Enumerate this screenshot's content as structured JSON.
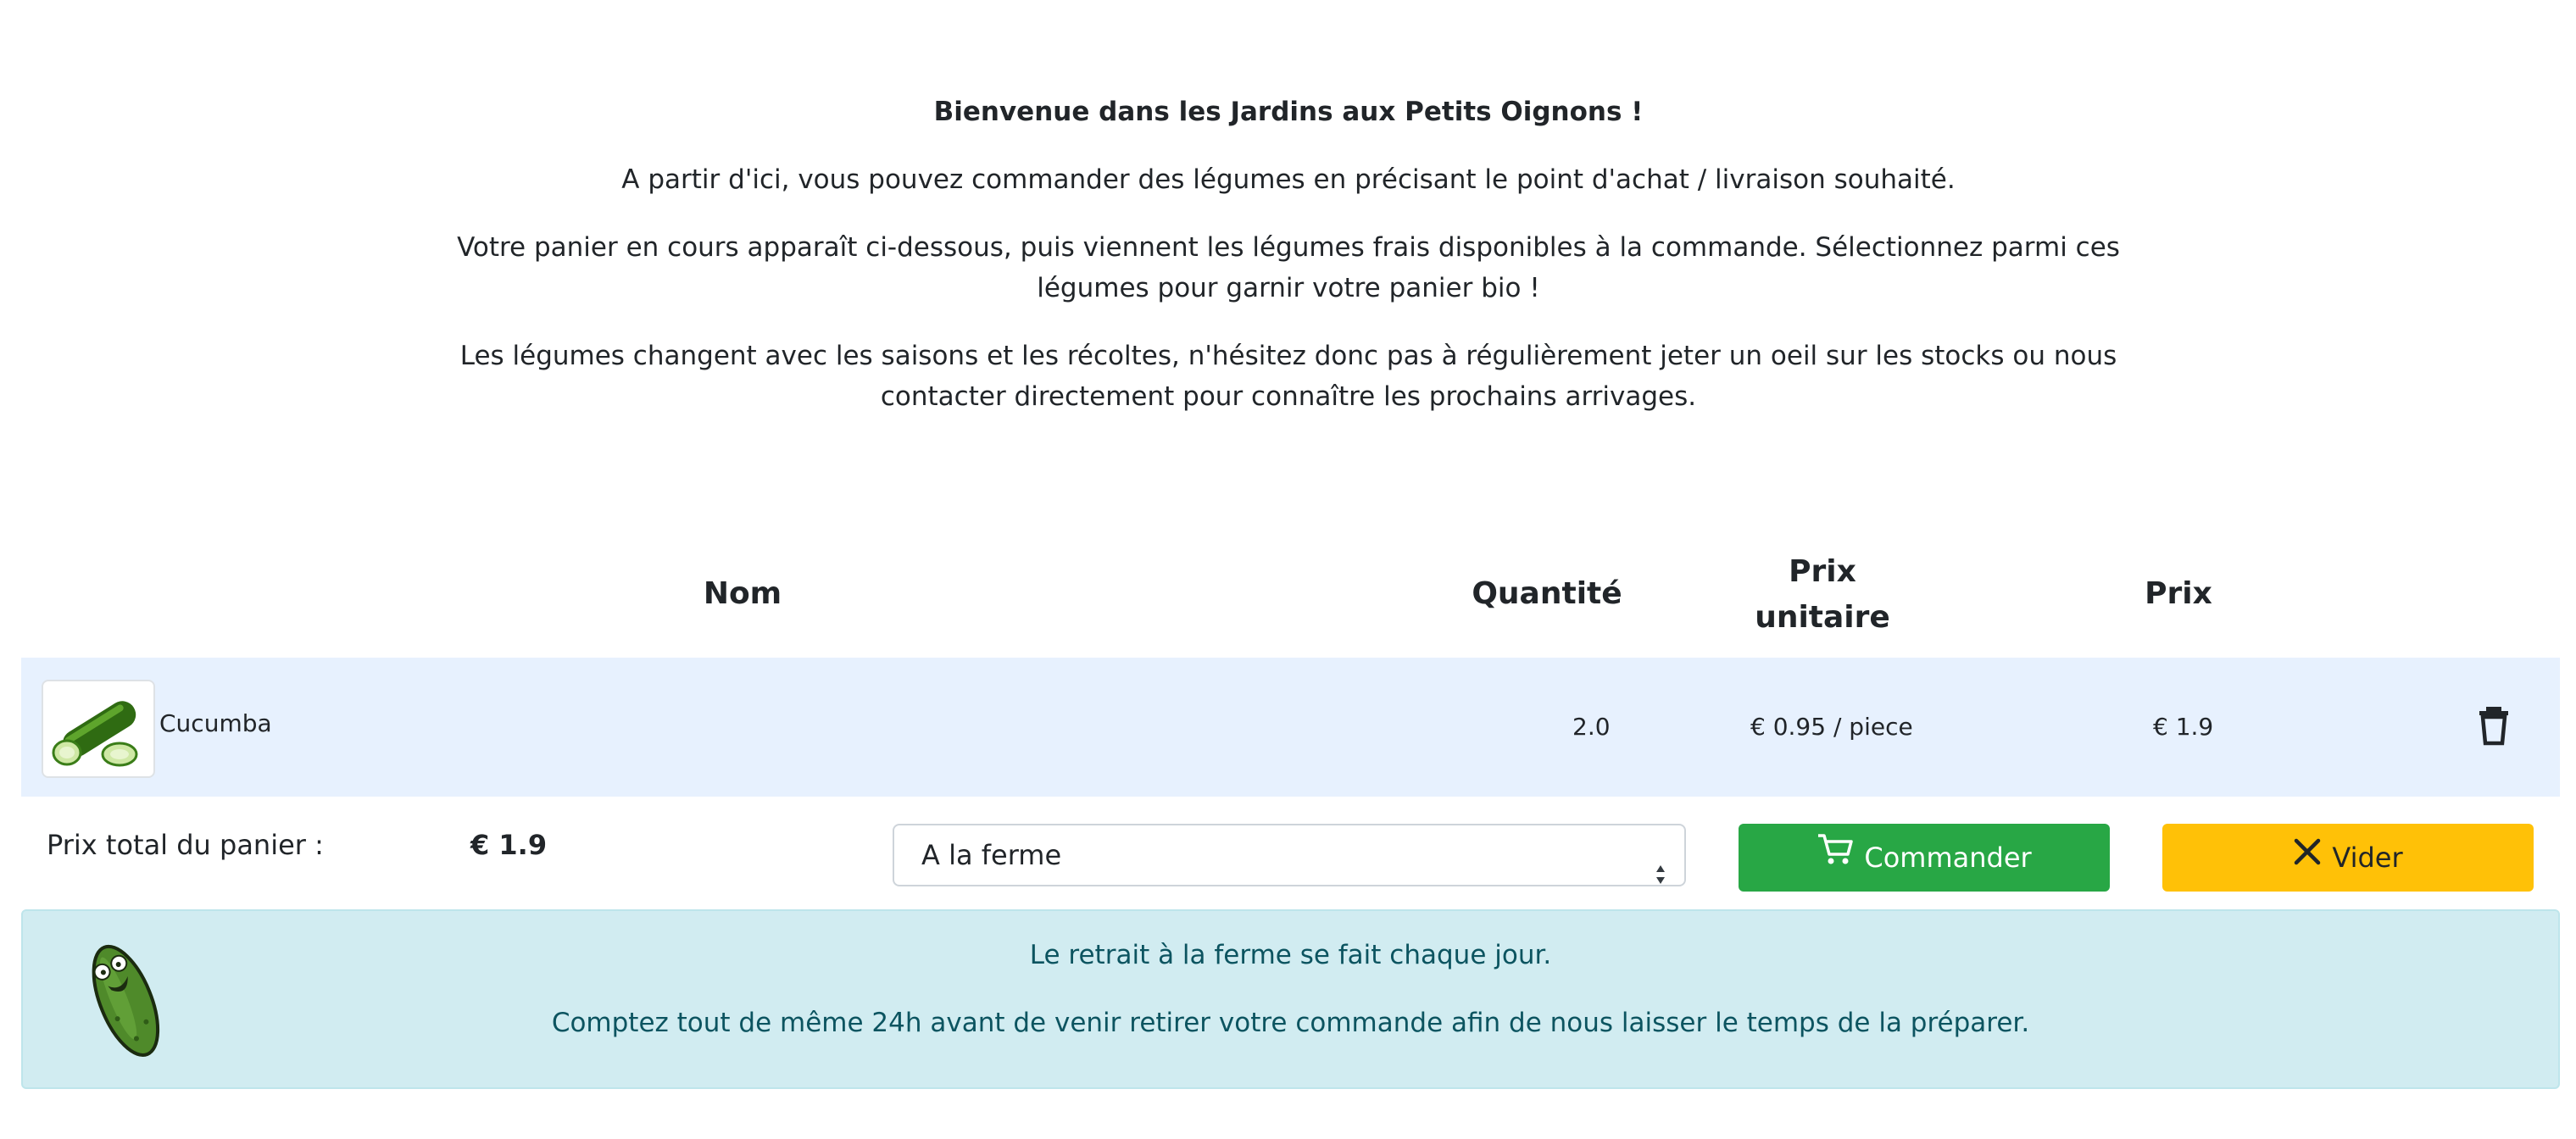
{
  "intro": {
    "welcome": "Bienvenue dans les Jardins aux Petits Oignons !",
    "line1": "A partir d'ici, vous pouvez commander des légumes en précisant le point d'achat / livraison souhaité.",
    "line2": "Votre panier en cours apparaît ci-dessous, puis viennent les légumes frais disponibles à la commande. Sélectionnez parmi ces légumes pour garnir votre panier bio !",
    "line3": "Les légumes changent avec les saisons et les récoltes, n'hésitez donc pas à régulièrement jeter un oeil sur les stocks ou nous contacter directement pour connaître les prochains arrivages."
  },
  "cart": {
    "headers": {
      "name": "Nom",
      "quantity": "Quantité",
      "unit_price": "Prix unitaire",
      "price": "Prix"
    },
    "items": [
      {
        "name": "Cucumba",
        "quantity": "2.0",
        "unit_price": "€ 0.95 / piece",
        "price": "€ 1.9"
      }
    ],
    "total_label": "Prix total du panier :",
    "total_value": "€ 1.9",
    "delivery_select": {
      "selected": "A la ferme"
    },
    "order_button": "Commander",
    "clear_button": "Vider"
  },
  "alert": {
    "line1": "Le retrait à la ferme se fait chaque jour.",
    "line2": "Comptez tout de même 24h avant de venir retirer votre commande afin de nous laisser le temps de la préparer."
  },
  "colors": {
    "row_bg": "#e7f1fe",
    "order_button": "#28a745",
    "clear_button": "#ffc107",
    "alert_bg": "#d1ecf1",
    "alert_text": "#0c5460"
  },
  "icons": [
    "cucumber-thumbnail-icon",
    "trash-icon",
    "cart-icon",
    "close-icon",
    "pickle-mascot-icon",
    "select-caret-icon"
  ]
}
